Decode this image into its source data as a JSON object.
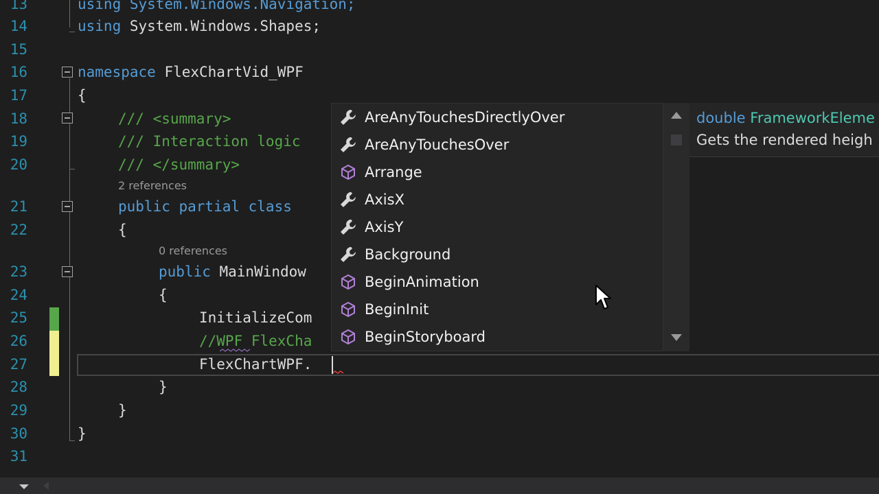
{
  "lines": [
    {
      "num": "13",
      "text": "using System.Windows.Navigation;"
    },
    {
      "num": "14",
      "text": "using System.Windows.Shapes;"
    },
    {
      "num": "15"
    },
    {
      "num": "16",
      "kw": "namespace",
      "rest": " FlexChartVid_WPF"
    },
    {
      "num": "17",
      "text": "{"
    },
    {
      "num": "18",
      "text": "/// <summary>"
    },
    {
      "num": "19",
      "text": "/// Interaction logic"
    },
    {
      "num": "20",
      "text": "/// </summary>"
    },
    {
      "num": "21",
      "text": "public partial class"
    },
    {
      "num": "22",
      "text": "{"
    },
    {
      "num": "23",
      "kw": "public",
      "rest": " MainWindow"
    },
    {
      "num": "24",
      "text": "{"
    },
    {
      "num": "25",
      "text": "InitializeCom"
    },
    {
      "num": "26",
      "text": "//WPF FlexCha"
    },
    {
      "num": "27",
      "text": "FlexChartWPF."
    },
    {
      "num": "28",
      "text": "}"
    },
    {
      "num": "29",
      "text": "}"
    },
    {
      "num": "30",
      "text": "}"
    },
    {
      "num": "31"
    }
  ],
  "codelens": {
    "class_refs": "2 references",
    "ctor_refs": "0 references"
  },
  "completion": {
    "items": [
      {
        "label": "AreAnyTouchesDirectlyOver",
        "icon": "wrench-icon"
      },
      {
        "label": "AreAnyTouchesOver",
        "icon": "wrench-icon"
      },
      {
        "label": "Arrange",
        "icon": "method-cube-icon"
      },
      {
        "label": "AxisX",
        "icon": "wrench-icon"
      },
      {
        "label": "AxisY",
        "icon": "wrench-icon"
      },
      {
        "label": "Background",
        "icon": "wrench-icon"
      },
      {
        "label": "BeginAnimation",
        "icon": "method-cube-icon"
      },
      {
        "label": "BeginInit",
        "icon": "method-cube-icon"
      },
      {
        "label": "BeginStoryboard",
        "icon": "method-cube-icon"
      }
    ]
  },
  "tooltip": {
    "type_keyword": "double",
    "member": "FrameworkEleme",
    "description": "Gets the rendered heigh"
  },
  "colors": {
    "keyword": "#569cd6",
    "comment": "#57a64a",
    "line_number": "#2b91af",
    "method_icon": "#b180d7",
    "change_saved": "#57a64a",
    "change_unsaved": "#efef91"
  }
}
